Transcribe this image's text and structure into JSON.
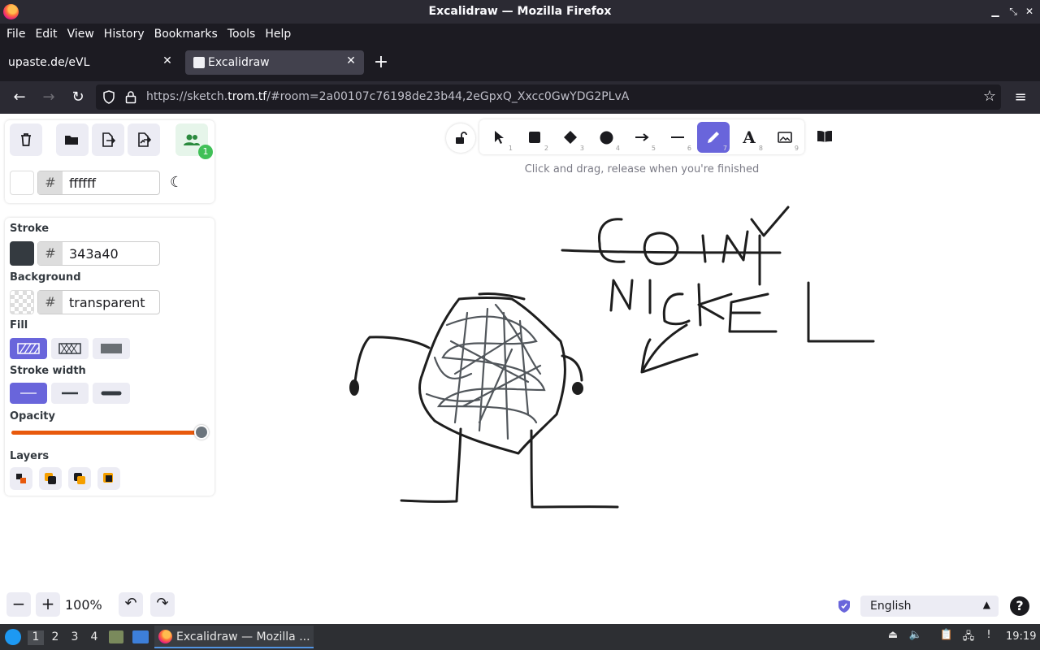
{
  "window": {
    "title": "Excalidraw — Mozilla Firefox"
  },
  "menu": [
    "File",
    "Edit",
    "View",
    "History",
    "Bookmarks",
    "Tools",
    "Help"
  ],
  "tabs": [
    {
      "label": "upaste.de/eVL",
      "active": false
    },
    {
      "label": "Excalidraw",
      "active": true
    }
  ],
  "url": {
    "prefix": "https://sketch.",
    "domain": "trom.tf",
    "suffix": "/#room=2a00107c76198de23b44,2eGpxQ_Xxcc0GwYDG2PLvA"
  },
  "canvas_bg": {
    "hash": "#",
    "value": "ffffff"
  },
  "collab_count": "1",
  "properties": {
    "stroke_label": "Stroke",
    "stroke_hash": "#",
    "stroke_value": "343a40",
    "stroke_color": "#343a40",
    "background_label": "Background",
    "background_hash": "#",
    "background_value": "transparent",
    "fill_label": "Fill",
    "stroke_width_label": "Stroke width",
    "opacity_label": "Opacity",
    "opacity_value": 100,
    "layers_label": "Layers"
  },
  "tools": [
    {
      "name": "selection",
      "key": "1"
    },
    {
      "name": "rectangle",
      "key": "2"
    },
    {
      "name": "diamond",
      "key": "3"
    },
    {
      "name": "ellipse",
      "key": "4"
    },
    {
      "name": "arrow",
      "key": "5"
    },
    {
      "name": "line",
      "key": "6"
    },
    {
      "name": "draw",
      "key": "7",
      "active": true
    },
    {
      "name": "text",
      "key": "8"
    },
    {
      "name": "image",
      "key": "9"
    }
  ],
  "hint": "Click and drag, release when you're finished",
  "zoom": "100%",
  "language": "English",
  "taskbar": {
    "workspaces": [
      "1",
      "2",
      "3",
      "4"
    ],
    "active_window": "Excalidraw — Mozilla ...",
    "clock": "19:19"
  },
  "colors": {
    "accent": "#6965db",
    "slider": "#e8590c"
  }
}
